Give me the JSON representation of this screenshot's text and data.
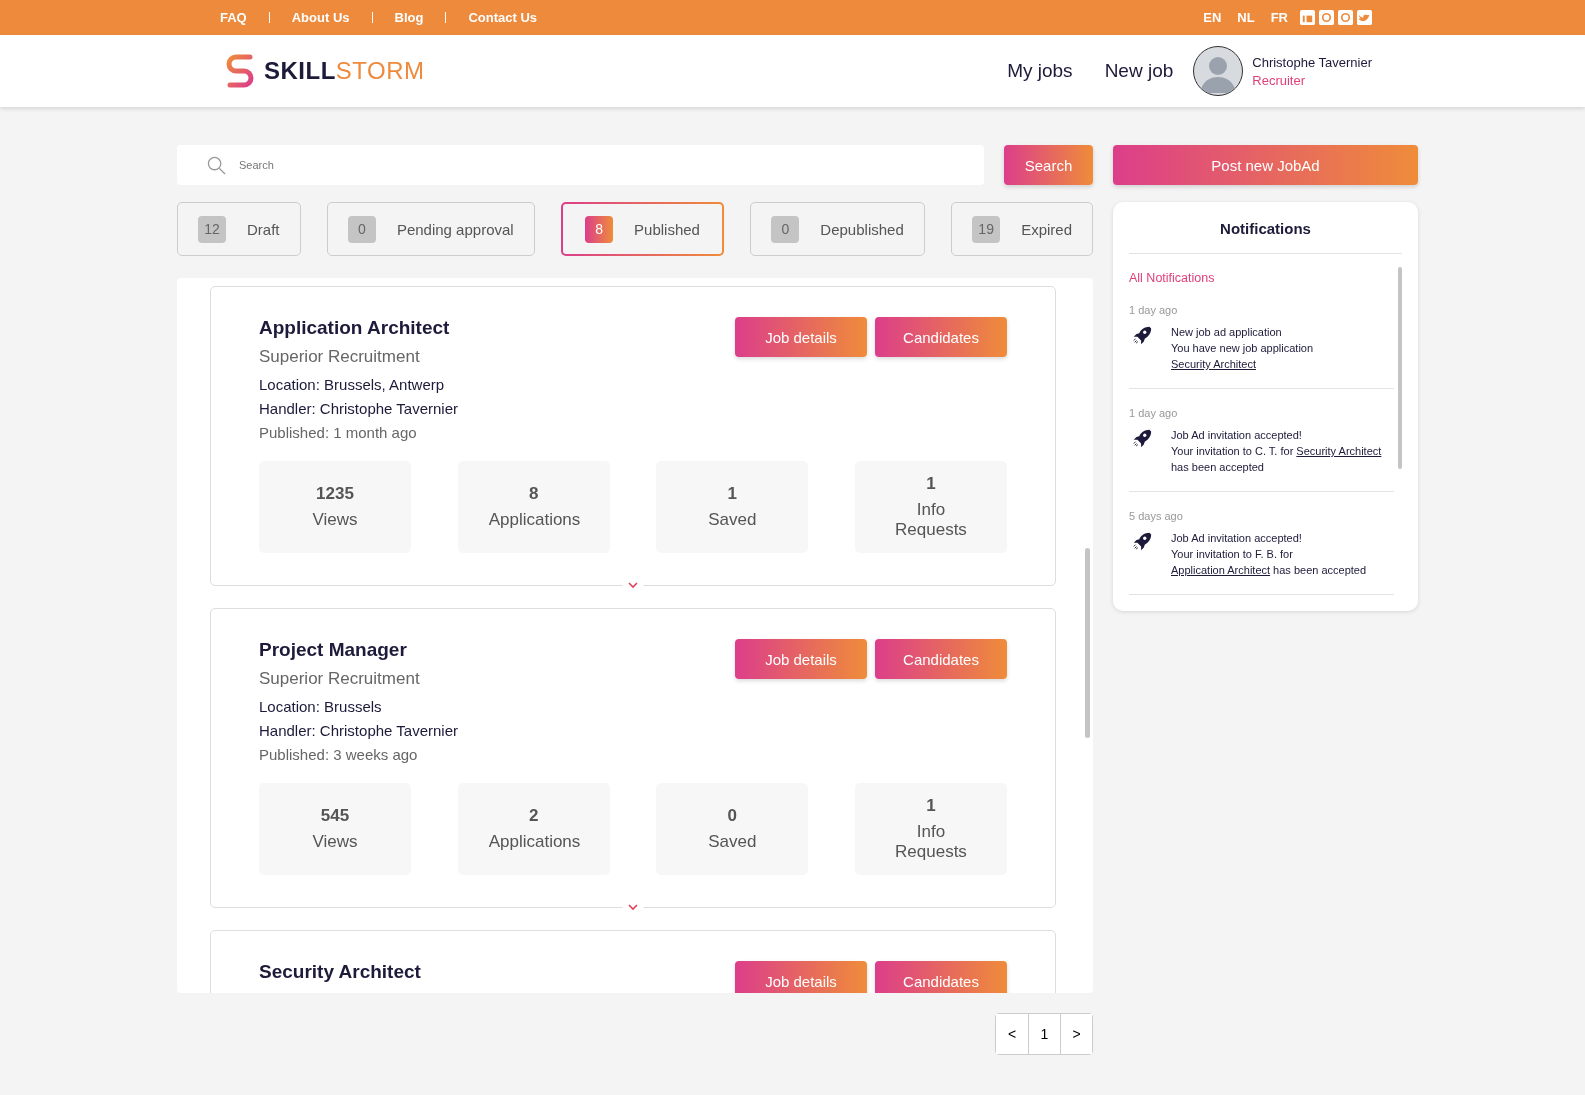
{
  "top_bar": {
    "links": [
      "FAQ",
      "About Us",
      "Blog",
      "Contact Us"
    ],
    "languages": [
      {
        "label": "EN",
        "selected": false
      },
      {
        "label": "NL",
        "selected": false
      },
      {
        "label": "FR",
        "selected": false
      }
    ]
  },
  "header": {
    "logo": {
      "part_1": "SKILL",
      "part_2": "STORM"
    },
    "nav": [
      "My jobs",
      "New job"
    ],
    "user": {
      "name": "Christophe Tavernier",
      "role": "Recruiter"
    }
  },
  "search": {
    "placeholder": "Search",
    "button": "Search"
  },
  "post_button": "Post new JobAd",
  "status_tabs": [
    {
      "count": "12",
      "label": "Draft",
      "selected": false
    },
    {
      "count": "0",
      "label": "Pending approval",
      "selected": false
    },
    {
      "count": "8",
      "label": "Published",
      "selected": true
    },
    {
      "count": "0",
      "label": "Depublished",
      "selected": false
    },
    {
      "count": "19",
      "label": "Expired",
      "selected": false
    }
  ],
  "jobs": [
    {
      "title": "Application Architect",
      "company": "Superior Recruitment",
      "location": "Location: Brussels, Antwerp",
      "handler": "Handler: Christophe Tavernier",
      "published": "Published: 1 month ago",
      "buttons": [
        "Job details",
        "Candidates"
      ],
      "stats": [
        {
          "value": "1235",
          "label": "Views"
        },
        {
          "value": "8",
          "label": "Applications"
        },
        {
          "value": "1",
          "label": "Saved"
        },
        {
          "value": "1",
          "label": "Info Requests"
        }
      ]
    },
    {
      "title": "Project Manager",
      "company": "Superior Recruitment",
      "location": "Location: Brussels",
      "handler": "Handler: Christophe Tavernier",
      "published": "Published: 3 weeks ago",
      "buttons": [
        "Job details",
        "Candidates"
      ],
      "stats": [
        {
          "value": "545",
          "label": "Views"
        },
        {
          "value": "2",
          "label": "Applications"
        },
        {
          "value": "0",
          "label": "Saved"
        },
        {
          "value": "1",
          "label": "Info Requests"
        }
      ]
    },
    {
      "title": "Security Architect",
      "buttons": [
        "Job details",
        "Candidates"
      ]
    }
  ],
  "notifications": {
    "title": "Notifications",
    "all_link": "All Notifications",
    "items": [
      {
        "time": "1 day ago",
        "heading": "New job ad application",
        "text_before": "You have new job application ",
        "link": "Security Architect"
      },
      {
        "time": "1 day ago",
        "heading": "Job Ad invitation accepted!",
        "text_before": "Your invitation to C. T. for ",
        "link": "Security Architect",
        "text_after": " has been accepted"
      },
      {
        "time": "5 days ago",
        "heading": "Job Ad invitation accepted!",
        "text_before": "Your invitation to F. B. for ",
        "link": "Application Architect",
        "text_after": " has been accepted"
      }
    ]
  },
  "pagination": [
    "<",
    "1",
    ">"
  ]
}
